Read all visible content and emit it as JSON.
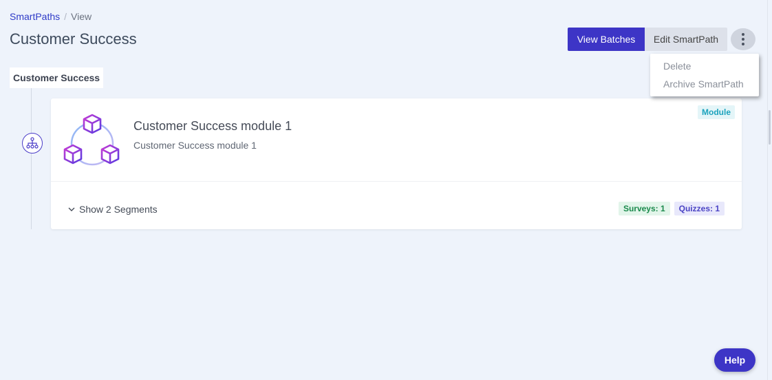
{
  "breadcrumb": {
    "root": "SmartPaths",
    "separator": "/",
    "current": "View"
  },
  "page": {
    "title": "Customer Success"
  },
  "actions": {
    "view_batches": "View Batches",
    "edit_smartpath": "Edit SmartPath",
    "more_icon": "kebab-vertical-icon"
  },
  "dropdown": {
    "items": [
      "Delete",
      "Archive SmartPath"
    ]
  },
  "path": {
    "name": "Customer Success",
    "node_icon": "sitemap-icon"
  },
  "module": {
    "title": "Customer Success module 1",
    "description": "Customer Success module 1",
    "badge": "Module",
    "graphic": "module-cubes-graphic",
    "segments_toggle": "Show 2 Segments",
    "tags": {
      "surveys": "Surveys: 1",
      "quizzes": "Quizzes: 1"
    }
  },
  "help": {
    "label": "Help"
  },
  "colors": {
    "primary": "#3d35c6",
    "background": "#eef3fb",
    "module_badge": "#1ca3bd",
    "survey_tag": "#1b8a4c",
    "quiz_tag": "#4a43c4"
  }
}
